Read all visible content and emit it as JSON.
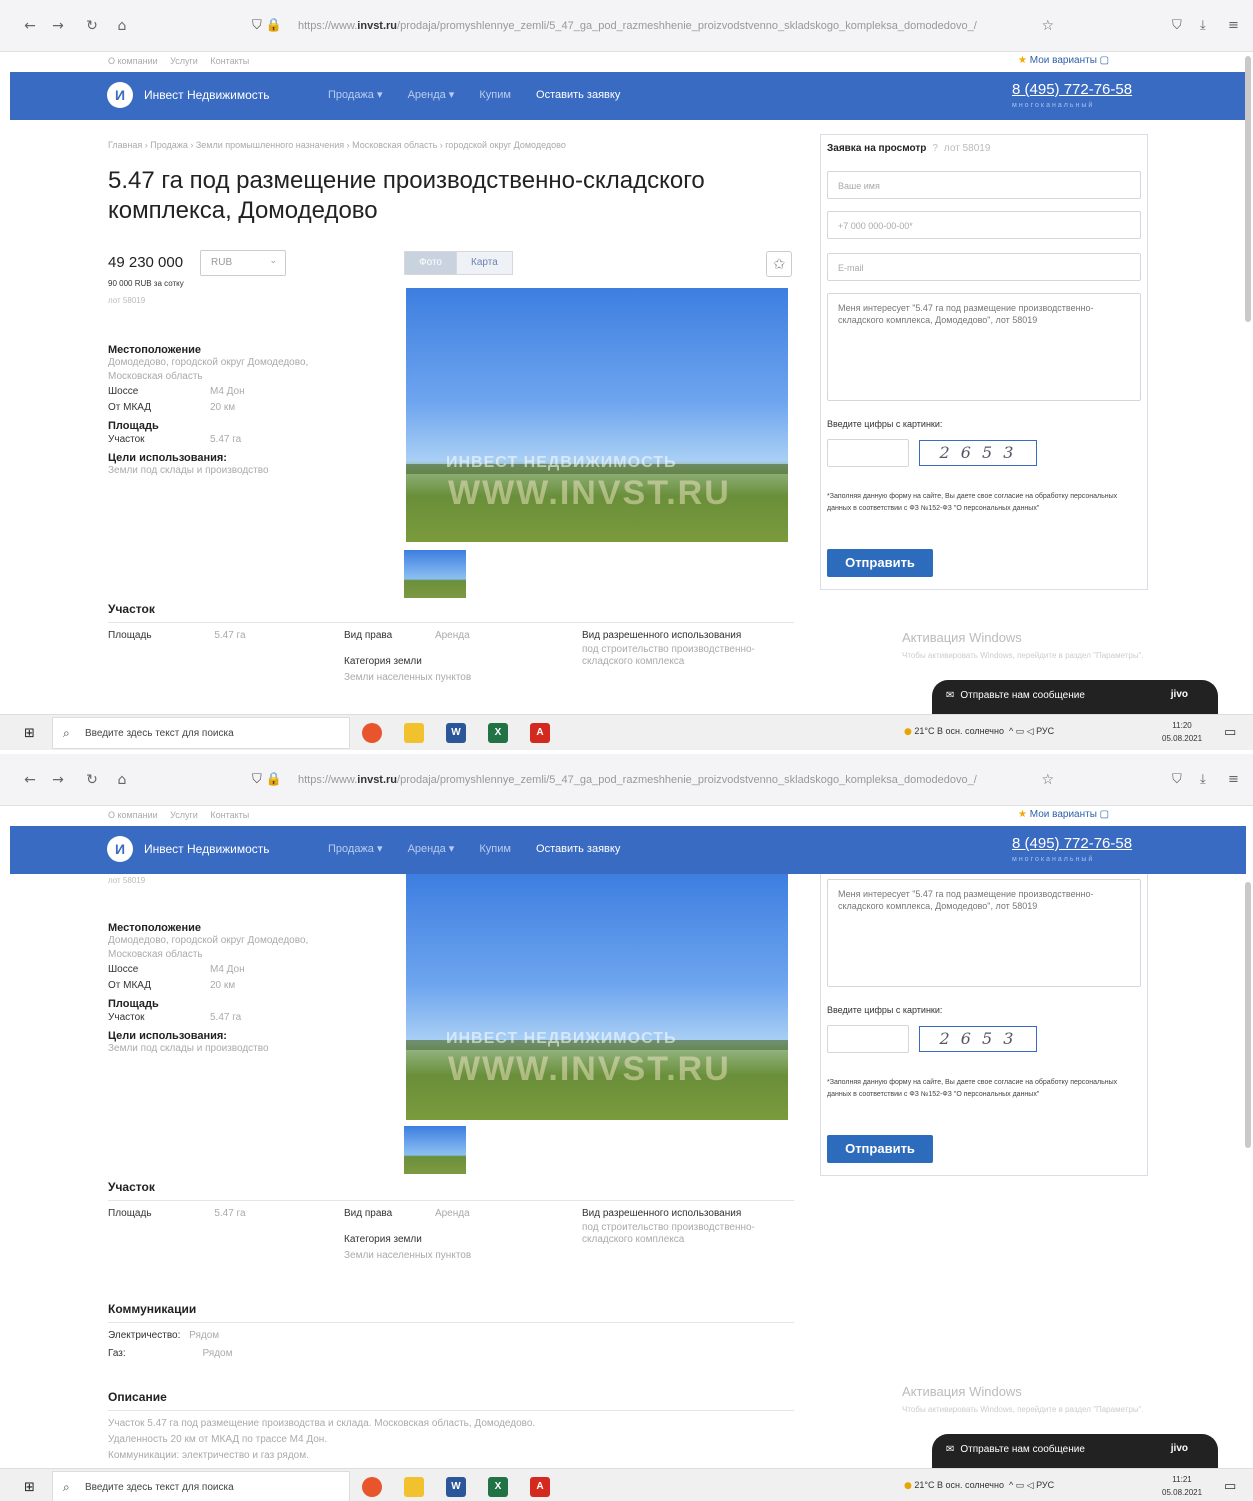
{
  "browser": {
    "url_prefix": "https://www.",
    "url_domain": "invst.ru",
    "url_path": "/prodaja/promyshlennye_zemli/5_47_ga_pod_razmeshhenie_proizvodstvenno_skladskogo_kompleksa_domodedovo_/"
  },
  "site": {
    "top_links": [
      "О компании",
      "Услуги",
      "Контакты"
    ],
    "favorites_label": "Мои варианты",
    "brand": "Инвест Недвижимость",
    "logo_letters": "И",
    "nav": [
      "Продажа ▾",
      "Аренда ▾",
      "Купим",
      "Оставить заявку"
    ],
    "phone": "8 (495) 772-76-58",
    "phone_sub": "многоканальный"
  },
  "listing": {
    "breadcrumbs": "Главная › Продажа › Земли промышленного назначения › Московская область › городской округ Домодедово",
    "title": "5.47 га под размещение производственно-складского комплекса, Домодедово",
    "price": "49 230 000",
    "currency": "RUB",
    "per_acre": "90 000 RUB за сотку",
    "lot": "лот 58019",
    "location_heading": "Местоположение",
    "location_text": "Домодедово, городской округ Домодедово, Московская область",
    "highway_label": "Шоссе",
    "highway_value": "М4 Дон",
    "mkad_label": "От МКАД",
    "mkad_value": "20 км",
    "area_heading": "Площадь",
    "plot_label": "Участок",
    "plot_value": "5.47 га",
    "purpose_heading": "Цели использования:",
    "purpose_value": "Земли под склады и производство",
    "tab_photo": "Фото",
    "tab_map": "Карта",
    "watermark_small": "ИНВЕСТ НЕДВИЖИМОСТЬ",
    "watermark_big": "WWW.INVST.RU"
  },
  "plot": {
    "heading": "Участок",
    "area_label": "Площадь",
    "area_value": "5.47 га",
    "right_label": "Вид права",
    "right_value": "Аренда",
    "category_label": "Категория земли",
    "category_value": "Земли населенных пунктов",
    "use_label": "Вид разрешенного использования",
    "use_value": "под строительство производственно-складского комплекса"
  },
  "communications": {
    "heading": "Коммуникации",
    "electricity_label": "Электричество:",
    "electricity_value": "Рядом",
    "gas_label": "Газ:",
    "gas_value": "Рядом"
  },
  "description": {
    "heading": "Описание",
    "lines": [
      "Участок 5.47 га под размещение производства и склада. Московская область, Домодедово.",
      "Удаленность 20 км от МКАД по трассе М4 Дон.",
      "Коммуникации: электричество и газ рядом."
    ]
  },
  "form": {
    "heading": "Заявка на просмотр",
    "help": "?",
    "lot_ref": "лот 58019",
    "name_placeholder": "Ваше имя",
    "phone_placeholder": "+7 000 000-00-00*",
    "email_placeholder": "E-mail",
    "message": "Меня интересует \"5.47 га под размещение производственно-складского комплекса, Домодедово\", лот 58019",
    "captcha_label": "Введите цифры с картинки:",
    "captcha_text": "2 6 5 3",
    "consent": "*Заполняя данную форму на сайте, Вы даете свое согласие на обработку персональных данных в соответствии с ФЗ №152-ФЗ \"О персональных данных\"",
    "submit": "Отправить"
  },
  "windows": {
    "activation_title": "Активация Windows",
    "activation_sub": "Чтобы активировать Windows, перейдите в раздел \"Параметры\".",
    "chat_label": "Отправьте нам сообщение",
    "chat_brand": "jivo",
    "search_placeholder": "Введите здесь текст для поиска",
    "tray": "21°C В осн. солнечно",
    "lang": "РУС",
    "time1": "11:20",
    "time2": "11:21",
    "date": "05.08.2021"
  },
  "colors": {
    "header_blue": "#3a6bc2",
    "submit_blue": "#2d6bbd"
  }
}
